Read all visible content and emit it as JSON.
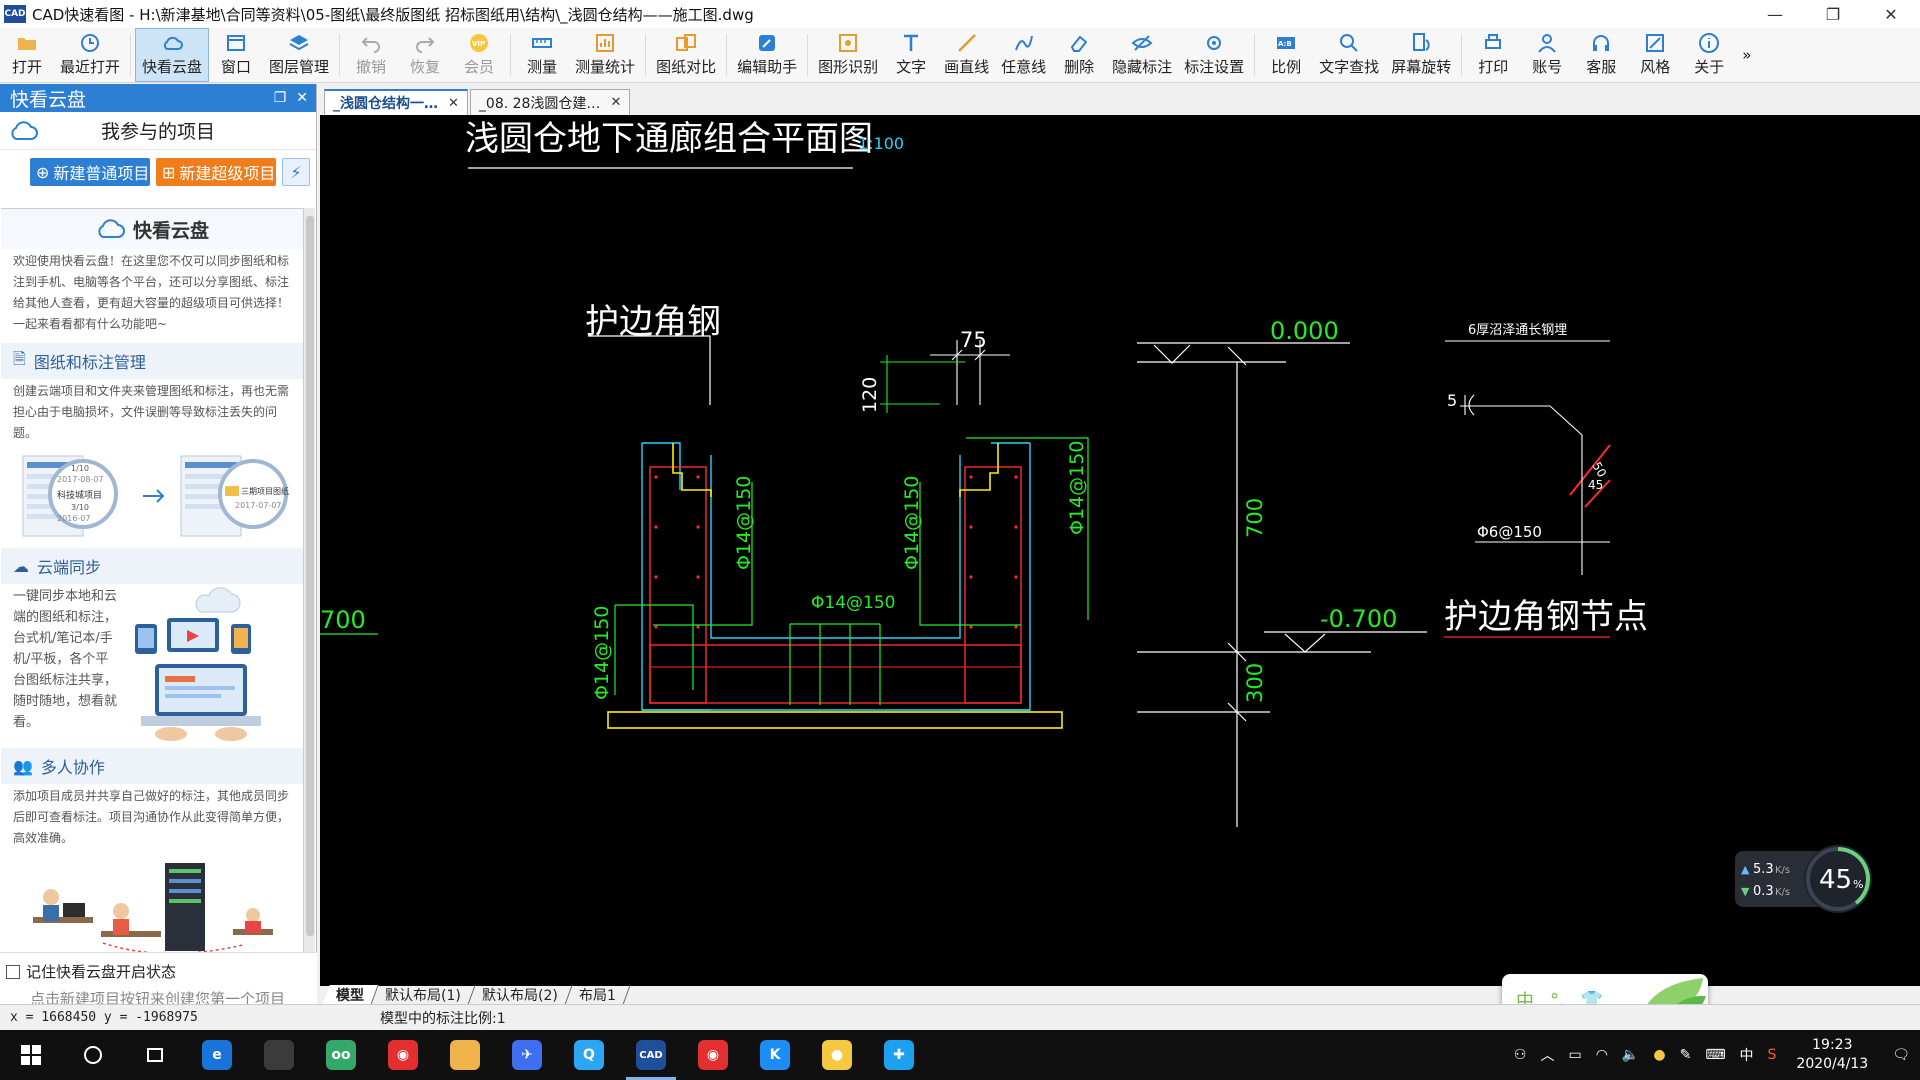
{
  "window": {
    "title": "CAD快速看图 - H:\\新津基地\\合同等资料\\05-图纸\\最终版图纸 招标图纸用\\结构\\_浅圆仓结构——施工图.dwg",
    "app_icon_text": "CAD",
    "minimize": "—",
    "restore": "❐",
    "close": "✕"
  },
  "toolbar": {
    "items": [
      {
        "label": "打开",
        "icon": "folder-icon",
        "state": "normal"
      },
      {
        "label": "最近打开",
        "icon": "clock-icon",
        "state": "normal"
      },
      {
        "label": "快看云盘",
        "icon": "cloud-icon",
        "state": "active"
      },
      {
        "label": "窗口",
        "icon": "window-icon",
        "state": "normal"
      },
      {
        "label": "图层管理",
        "icon": "layers-icon",
        "state": "normal"
      },
      {
        "label": "撤销",
        "icon": "undo-icon",
        "state": "disabled"
      },
      {
        "label": "恢复",
        "icon": "redo-icon",
        "state": "disabled"
      },
      {
        "label": "会员",
        "icon": "vip-icon",
        "state": "disabled"
      },
      {
        "label": "测量",
        "icon": "measure-icon",
        "state": "normal"
      },
      {
        "label": "测量统计",
        "icon": "measure-stats-icon",
        "state": "normal"
      },
      {
        "label": "图纸对比",
        "icon": "compare-icon",
        "state": "normal"
      },
      {
        "label": "编辑助手",
        "icon": "edit-helper-icon",
        "state": "normal"
      },
      {
        "label": "图形识别",
        "icon": "shape-recognize-icon",
        "state": "normal"
      },
      {
        "label": "文字",
        "icon": "text-icon",
        "state": "normal"
      },
      {
        "label": "画直线",
        "icon": "line-icon",
        "state": "normal"
      },
      {
        "label": "任意线",
        "icon": "freehand-icon",
        "state": "normal"
      },
      {
        "label": "删除",
        "icon": "eraser-icon",
        "state": "normal"
      },
      {
        "label": "隐藏标注",
        "icon": "eye-hide-icon",
        "state": "normal"
      },
      {
        "label": "标注设置",
        "icon": "annotation-settings-icon",
        "state": "normal"
      },
      {
        "label": "比例",
        "icon": "scale-icon",
        "state": "normal"
      },
      {
        "label": "文字查找",
        "icon": "text-search-icon",
        "state": "normal"
      },
      {
        "label": "屏幕旋转",
        "icon": "rotate-screen-icon",
        "state": "normal"
      },
      {
        "label": "打印",
        "icon": "printer-icon",
        "state": "normal"
      },
      {
        "label": "账号",
        "icon": "user-icon",
        "state": "normal"
      },
      {
        "label": "客服",
        "icon": "headset-icon",
        "state": "normal"
      },
      {
        "label": "风格",
        "icon": "style-icon",
        "state": "normal"
      },
      {
        "label": "关于",
        "icon": "info-icon",
        "state": "normal"
      }
    ],
    "more": "»",
    "accent_color": "#2d7fd3",
    "vip_badge": "VIP",
    "scale_badge": "A:B"
  },
  "side_panel": {
    "header": "快看云盘",
    "project_title": "我参与的项目",
    "btn_new_normal": "新建普通项目",
    "btn_new_super": "新建超级项目",
    "intro_title": "快看云盘",
    "intro_text": "欢迎使用快看云盘！在这里您不仅可以同步图纸和标注到手机、电脑等各个平台，还可以分享图纸、标注给其他人查看，更有超大容量的超级项目可供选择！一起来看看都有什么功能吧~",
    "sections": [
      {
        "title": "图纸和标注管理",
        "text": "创建云端项目和文件夹来管理图纸和标注，再也无需担心由于电脑损坏，文件误删等导致标注丢失的问题。"
      },
      {
        "title": "云端同步",
        "text": "一键同步本地和云端的图纸和标注，台式机/笔记本/手机/平板，各个平台图纸标注共享，随时随地，想看就看。"
      },
      {
        "title": "多人协作",
        "text": "添加项目成员并共享自己做好的标注，其他成员同步后即可查看标注。项目沟通协作从此变得简单方便，高效准确。"
      }
    ],
    "illus_labels": {
      "date1": "2017-08-07",
      "item1": "科技城项目",
      "date2": "2016-07",
      "item2": "三期项目图纸",
      "date3": "2017-07-07",
      "ratio1": "1/10",
      "ratio2": "3/10"
    },
    "remember_label": "记住快看云盘开启状态",
    "hint": "点击新建项目按钮来创建您第一个项目"
  },
  "drawing_tabs": [
    {
      "label": "_浅圆仓结构一…",
      "active": true
    },
    {
      "label": "_08. 28浅圆仓建…",
      "active": false
    }
  ],
  "tab_close": "✕",
  "drawing": {
    "title": "浅圆仓地下通廊组合平面图",
    "scale_text": "1:100",
    "label_angle": "护边角钢",
    "label_angle_detail": "护边角钢节点",
    "dim_75": "75",
    "dim_120": "120",
    "elev_top": "0.000",
    "elev_bottom": "-0.700",
    "dim_700": "700",
    "dim_300": "300",
    "rebar_1": "Φ14@150",
    "rebar_2": "Φ14@150",
    "rebar_3": "Φ14@150",
    "rebar_4": "Φ14@150",
    "rebar_5": "Φ14@150",
    "rebar_6": "Φ6@150",
    "plate_note": "6厚沼泽通长钢埋",
    "left_dim": "700",
    "num_5": "5",
    "num_50": "50",
    "num_45": "45"
  },
  "layout_tabs": [
    "模型",
    "默认布局(1)",
    "默认布局(2)",
    "布局1"
  ],
  "status": {
    "coords": "x = 1668450  y = -1968975",
    "scale": "模型中的标注比例:1"
  },
  "net_widget": {
    "up": "5.3",
    "down": "0.3",
    "unit": "K/s",
    "percent": "45",
    "percent_unit": "%"
  },
  "ime": {
    "lang": "中",
    "punct": "°,",
    "skin": "👕"
  },
  "taskbar": {
    "apps": [
      {
        "name": "start-icon",
        "text": ""
      },
      {
        "name": "search-icon",
        "text": ""
      },
      {
        "name": "task-view-icon",
        "text": ""
      },
      {
        "name": "edge-icon",
        "text": "e"
      },
      {
        "name": "store-icon",
        "text": ""
      },
      {
        "name": "tripadvisor-icon",
        "text": "oo"
      },
      {
        "name": "netease-music-icon",
        "text": "◉"
      },
      {
        "name": "file-explorer-icon",
        "text": ""
      },
      {
        "name": "feishu-icon",
        "text": "✈"
      },
      {
        "name": "qq-browser-icon",
        "text": "Q"
      },
      {
        "name": "cad-viewer-icon",
        "text": "CAD"
      },
      {
        "name": "netease-music-2-icon",
        "text": "◉"
      },
      {
        "name": "kugou-icon",
        "text": "K"
      },
      {
        "name": "sphere-app-icon",
        "text": "●"
      },
      {
        "name": "cross-app-icon",
        "text": "✚"
      }
    ],
    "tray": {
      "lang": "中",
      "time": "19:23",
      "date": "2020/4/13"
    }
  }
}
